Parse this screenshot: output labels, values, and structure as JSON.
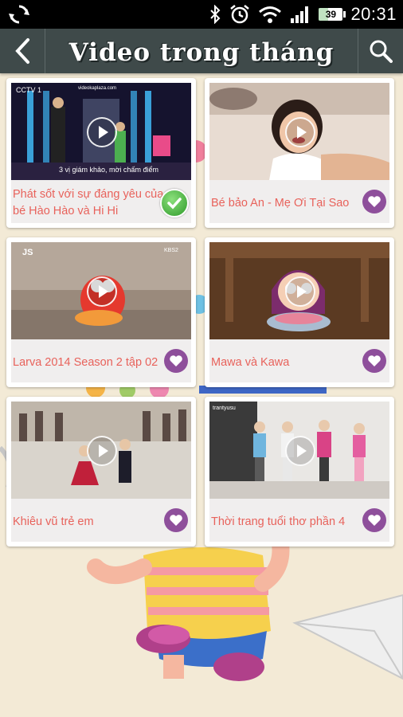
{
  "status_bar": {
    "time": "20:31",
    "battery": "39",
    "battery_level_percent": 39,
    "icons": [
      "sync-icon",
      "bluetooth-icon",
      "alarm-icon",
      "wifi-icon",
      "signal-icon",
      "battery-icon"
    ]
  },
  "header": {
    "title": "Video trong tháng",
    "back_icon": "chevron-left-icon",
    "search_icon": "search-icon"
  },
  "videos": [
    {
      "title": "Phát sốt với sự đáng yêu của bé Hào Hào và Hi Hi",
      "status_icon": "check-icon"
    },
    {
      "title": "Bé bảo An - Mẹ Ơi Tại Sao",
      "status_icon": "heart-icon"
    },
    {
      "title": "Larva 2014 Season 2 tập 02",
      "status_icon": "heart-icon"
    },
    {
      "title": "Mawa và Kawa",
      "status_icon": "heart-icon"
    },
    {
      "title": "Khiêu vũ trẻ em",
      "status_icon": "heart-icon"
    },
    {
      "title": "Thời trang tuổi thơ phần 4",
      "status_icon": "heart-icon"
    }
  ],
  "thumbnail_overlays": {
    "v1_channel": "CCTV 1",
    "v1_site": "videokaplaza.com",
    "v1_subtitle": "3 vị giám khảo, mời chấm điểm",
    "v3_mark": "JS",
    "v3_corner": "KBS2",
    "v6_mark": "trantyusu"
  },
  "colors": {
    "accent_text": "#e8625b",
    "heart_button": "#8e4f9b",
    "header_bg": "#3f4a4a",
    "check_green": "#3aa832"
  }
}
